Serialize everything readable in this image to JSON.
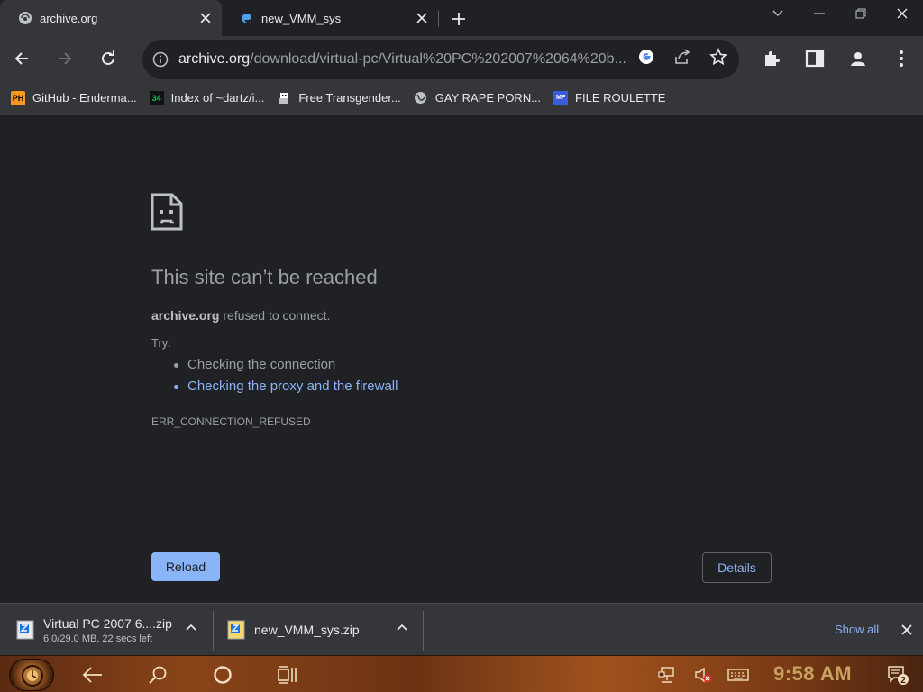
{
  "tabs": [
    {
      "title": "archive.org",
      "active": true
    },
    {
      "title": "new_VMM_sys",
      "active": false
    }
  ],
  "toolbar": {
    "url_host": "archive.org",
    "url_path": "/download/virtual-pc/Virtual%20PC%202007%2064%20b..."
  },
  "bookmarks": [
    {
      "label": "GitHub - Enderma...",
      "icon_text": "PH",
      "icon_color": "#f7971d"
    },
    {
      "label": "Index of ~dartz/i...",
      "icon_text": "34",
      "icon_color": "#00cc44"
    },
    {
      "label": "Free Transgender...",
      "icon_text": "",
      "icon_color": "#ffffff"
    },
    {
      "label": "GAY RAPE PORN...",
      "icon_text": "",
      "icon_color": "#bdc1c6"
    },
    {
      "label": "FILE ROULETTE",
      "icon_text": "MF",
      "icon_color": "#3b5bdb"
    }
  ],
  "error": {
    "title": "This site can’t be reached",
    "host": "archive.org",
    "message": " refused to connect.",
    "try_label": "Try:",
    "suggestions": [
      {
        "text": "Checking the connection",
        "link": false
      },
      {
        "text": "Checking the proxy and the firewall",
        "link": true
      }
    ],
    "code": "ERR_CONNECTION_REFUSED",
    "reload_label": "Reload",
    "details_label": "Details"
  },
  "downloads": [
    {
      "name": "Virtual PC 2007 6....zip",
      "status": "6.0/29.0 MB, 22 secs left"
    },
    {
      "name": "new_VMM_sys.zip",
      "status": ""
    }
  ],
  "shelf": {
    "show_all_label": "Show all"
  },
  "taskbar": {
    "time": "9:58 AM",
    "notification_count": "2"
  },
  "colors": {
    "accent": "#8ab4f8",
    "page_bg": "#202124",
    "toolbar_bg": "#35363a"
  }
}
